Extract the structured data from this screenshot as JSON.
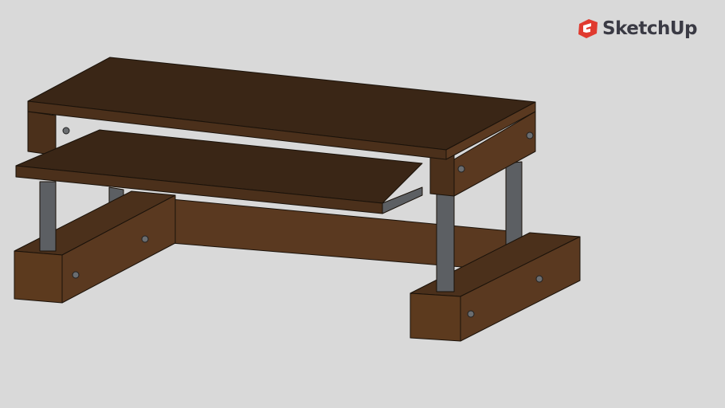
{
  "brand": {
    "name": "SketchUp",
    "logo_color": "#e03a2f",
    "text_color": "#3a3a44"
  },
  "colors": {
    "background": "#d9d9d9",
    "wood_top": "#3a2616",
    "wood_front": "#4b301b",
    "wood_side": "#5a3920",
    "metal": "#5c5f63",
    "edge": "#1a120a"
  }
}
